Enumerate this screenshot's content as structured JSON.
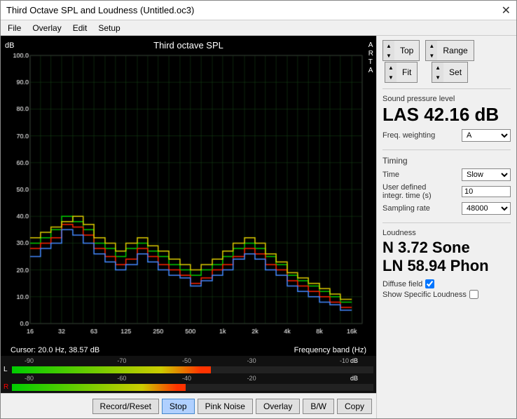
{
  "window": {
    "title": "Third Octave SPL and Loudness (Untitled.oc3)",
    "close_label": "✕"
  },
  "menu": {
    "items": [
      "File",
      "Overlay",
      "Edit",
      "Setup"
    ]
  },
  "chart": {
    "title": "Third octave SPL",
    "db_label": "dB",
    "arta_label": "A\nR\nT\nA",
    "cursor_info": "Cursor:  20.0 Hz, 38.57 dB",
    "freq_label": "Frequency band (Hz)",
    "x_labels": [
      "16",
      "32",
      "63",
      "125",
      "250",
      "500",
      "1k",
      "2k",
      "4k",
      "8k",
      "16k"
    ],
    "y_labels": [
      "100.0",
      "90.0",
      "80.0",
      "70.0",
      "60.0",
      "50.0",
      "40.0",
      "30.0",
      "20.0",
      "10.0"
    ],
    "grid_color": "#1a4d1a",
    "bg_color": "#000"
  },
  "controls": {
    "top_label": "Top",
    "fit_label": "Fit",
    "range_label": "Range",
    "set_label": "Set"
  },
  "spl": {
    "section_label": "Sound pressure level",
    "value": "LAS 42.16 dB",
    "freq_weighting_label": "Freq. weighting",
    "freq_weighting_value": "A"
  },
  "timing": {
    "section_label": "Timing",
    "time_label": "Time",
    "time_value": "Slow",
    "user_defined_label": "User defined\nintegr. time (s)",
    "user_defined_value": "10",
    "sampling_rate_label": "Sampling rate",
    "sampling_rate_value": "48000"
  },
  "loudness": {
    "section_label": "Loudness",
    "n_value": "N 3.72 Sone",
    "ln_value": "LN 58.94 Phon",
    "diffuse_field_label": "Diffuse field",
    "diffuse_field_checked": true,
    "show_specific_label": "Show Specific Loudness",
    "show_specific_checked": false
  },
  "level_bar": {
    "l_label": "L",
    "r_label": "R",
    "ticks": [
      "-90",
      "-70",
      "-50",
      "-30",
      "-10"
    ],
    "ticks_r": [
      "-80",
      "-60",
      "-40",
      "-20"
    ],
    "unit": "dB",
    "l_fill_pct": 42,
    "r_fill_pct": 38
  },
  "buttons": {
    "record_reset": "Record/Reset",
    "stop": "Stop",
    "pink_noise": "Pink Noise",
    "overlay": "Overlay",
    "bw": "B/W",
    "copy": "Copy"
  }
}
